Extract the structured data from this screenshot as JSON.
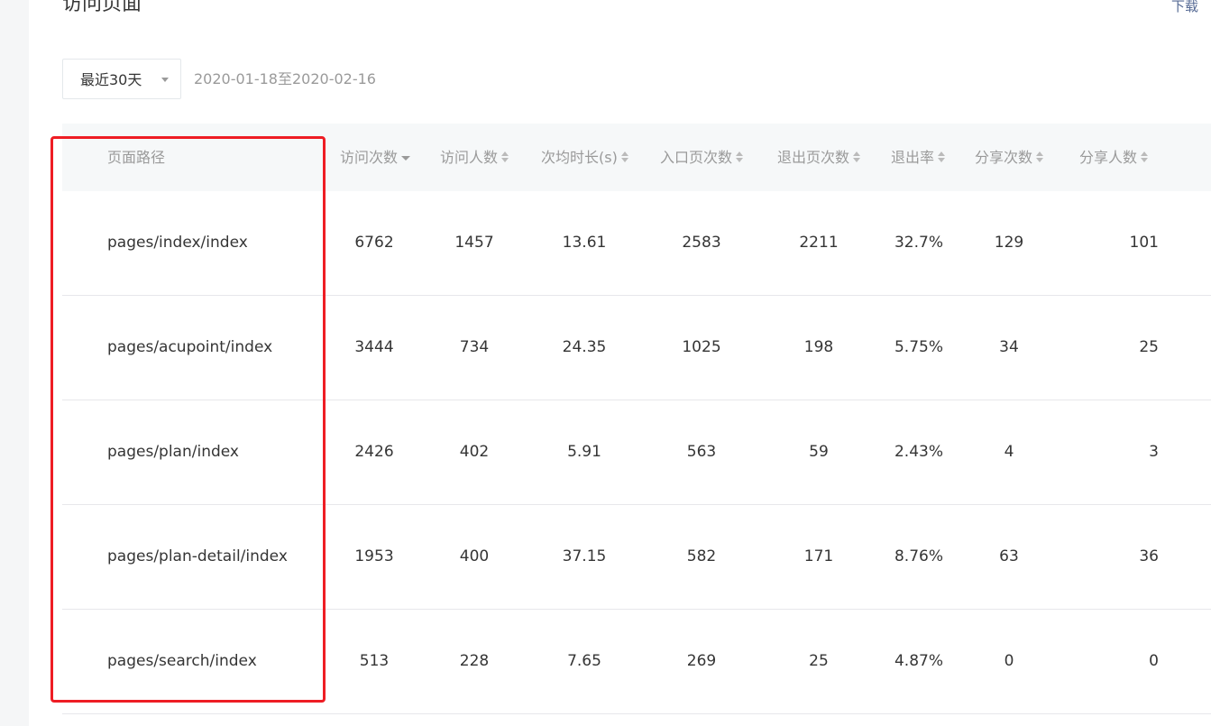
{
  "page": {
    "title": "访问页面",
    "download_label": "下载"
  },
  "filter": {
    "selected_range": "最近30天",
    "date_range": "2020-01-18至2020-02-16"
  },
  "table": {
    "columns": [
      "页面路径",
      "访问次数",
      "访问人数",
      "次均时长(s)",
      "入口页次数",
      "退出页次数",
      "退出率",
      "分享次数",
      "分享人数"
    ],
    "sorted_column": "访问次数",
    "sort_direction": "descending",
    "rows": [
      [
        "pages/index/index",
        "6762",
        "1457",
        "13.61",
        "2583",
        "2211",
        "32.7%",
        "129",
        "101"
      ],
      [
        "pages/acupoint/index",
        "3444",
        "734",
        "24.35",
        "1025",
        "198",
        "5.75%",
        "34",
        "25"
      ],
      [
        "pages/plan/index",
        "2426",
        "402",
        "5.91",
        "563",
        "59",
        "2.43%",
        "4",
        "3"
      ],
      [
        "pages/plan-detail/index",
        "1953",
        "400",
        "37.15",
        "582",
        "171",
        "8.76%",
        "63",
        "36"
      ],
      [
        "pages/search/index",
        "513",
        "228",
        "7.65",
        "269",
        "25",
        "4.87%",
        "0",
        "0"
      ]
    ]
  },
  "colors": {
    "highlight_border": "#ee1d24",
    "link": "#576b95",
    "header_bg": "#f6f8f9",
    "muted_text": "#9a9a9a"
  }
}
